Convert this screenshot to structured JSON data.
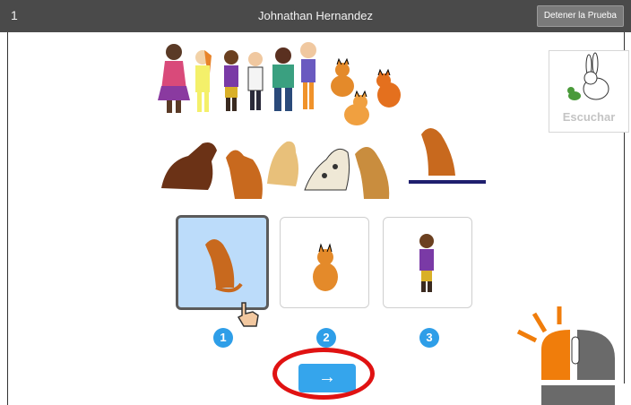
{
  "header": {
    "question_number": "1",
    "student_name": "Johnathan Hernandez",
    "stop_button_label": "Detener la Prueba"
  },
  "listen_button": {
    "label": "Escuchar",
    "icon": "bird-rabbit-icon"
  },
  "scene": {
    "row1": [
      "girl-figure",
      "girl-yellow-figure",
      "boy-figure",
      "boy-figure",
      "boy-green-figure",
      "boy-orange-figure",
      "cat-figure",
      "cat-figure",
      "cat-figure"
    ],
    "row2": [
      "dog-brown-lying",
      "dog-sitting",
      "dog-tan-sitting",
      "dog-spotted-sitting",
      "dog-tan-sitting"
    ],
    "blank_target": "dog-sitting",
    "colors": {
      "underline": "#1f1f6e",
      "dog_orange": "#c8691e",
      "dog_brown": "#6b3216",
      "cat_orange": "#e48a2a"
    }
  },
  "options": [
    {
      "number": "1",
      "picture": "dog-icon",
      "selected": true
    },
    {
      "number": "2",
      "picture": "cat-icon",
      "selected": false
    },
    {
      "number": "3",
      "picture": "boy-icon",
      "selected": false
    }
  ],
  "next_button": {
    "label": "→"
  },
  "colors": {
    "accent": "#35a5ec",
    "selected_bg": "#bcdcfa",
    "highlight_ring": "#e01212",
    "mouse_accent": "#f07d0b"
  }
}
